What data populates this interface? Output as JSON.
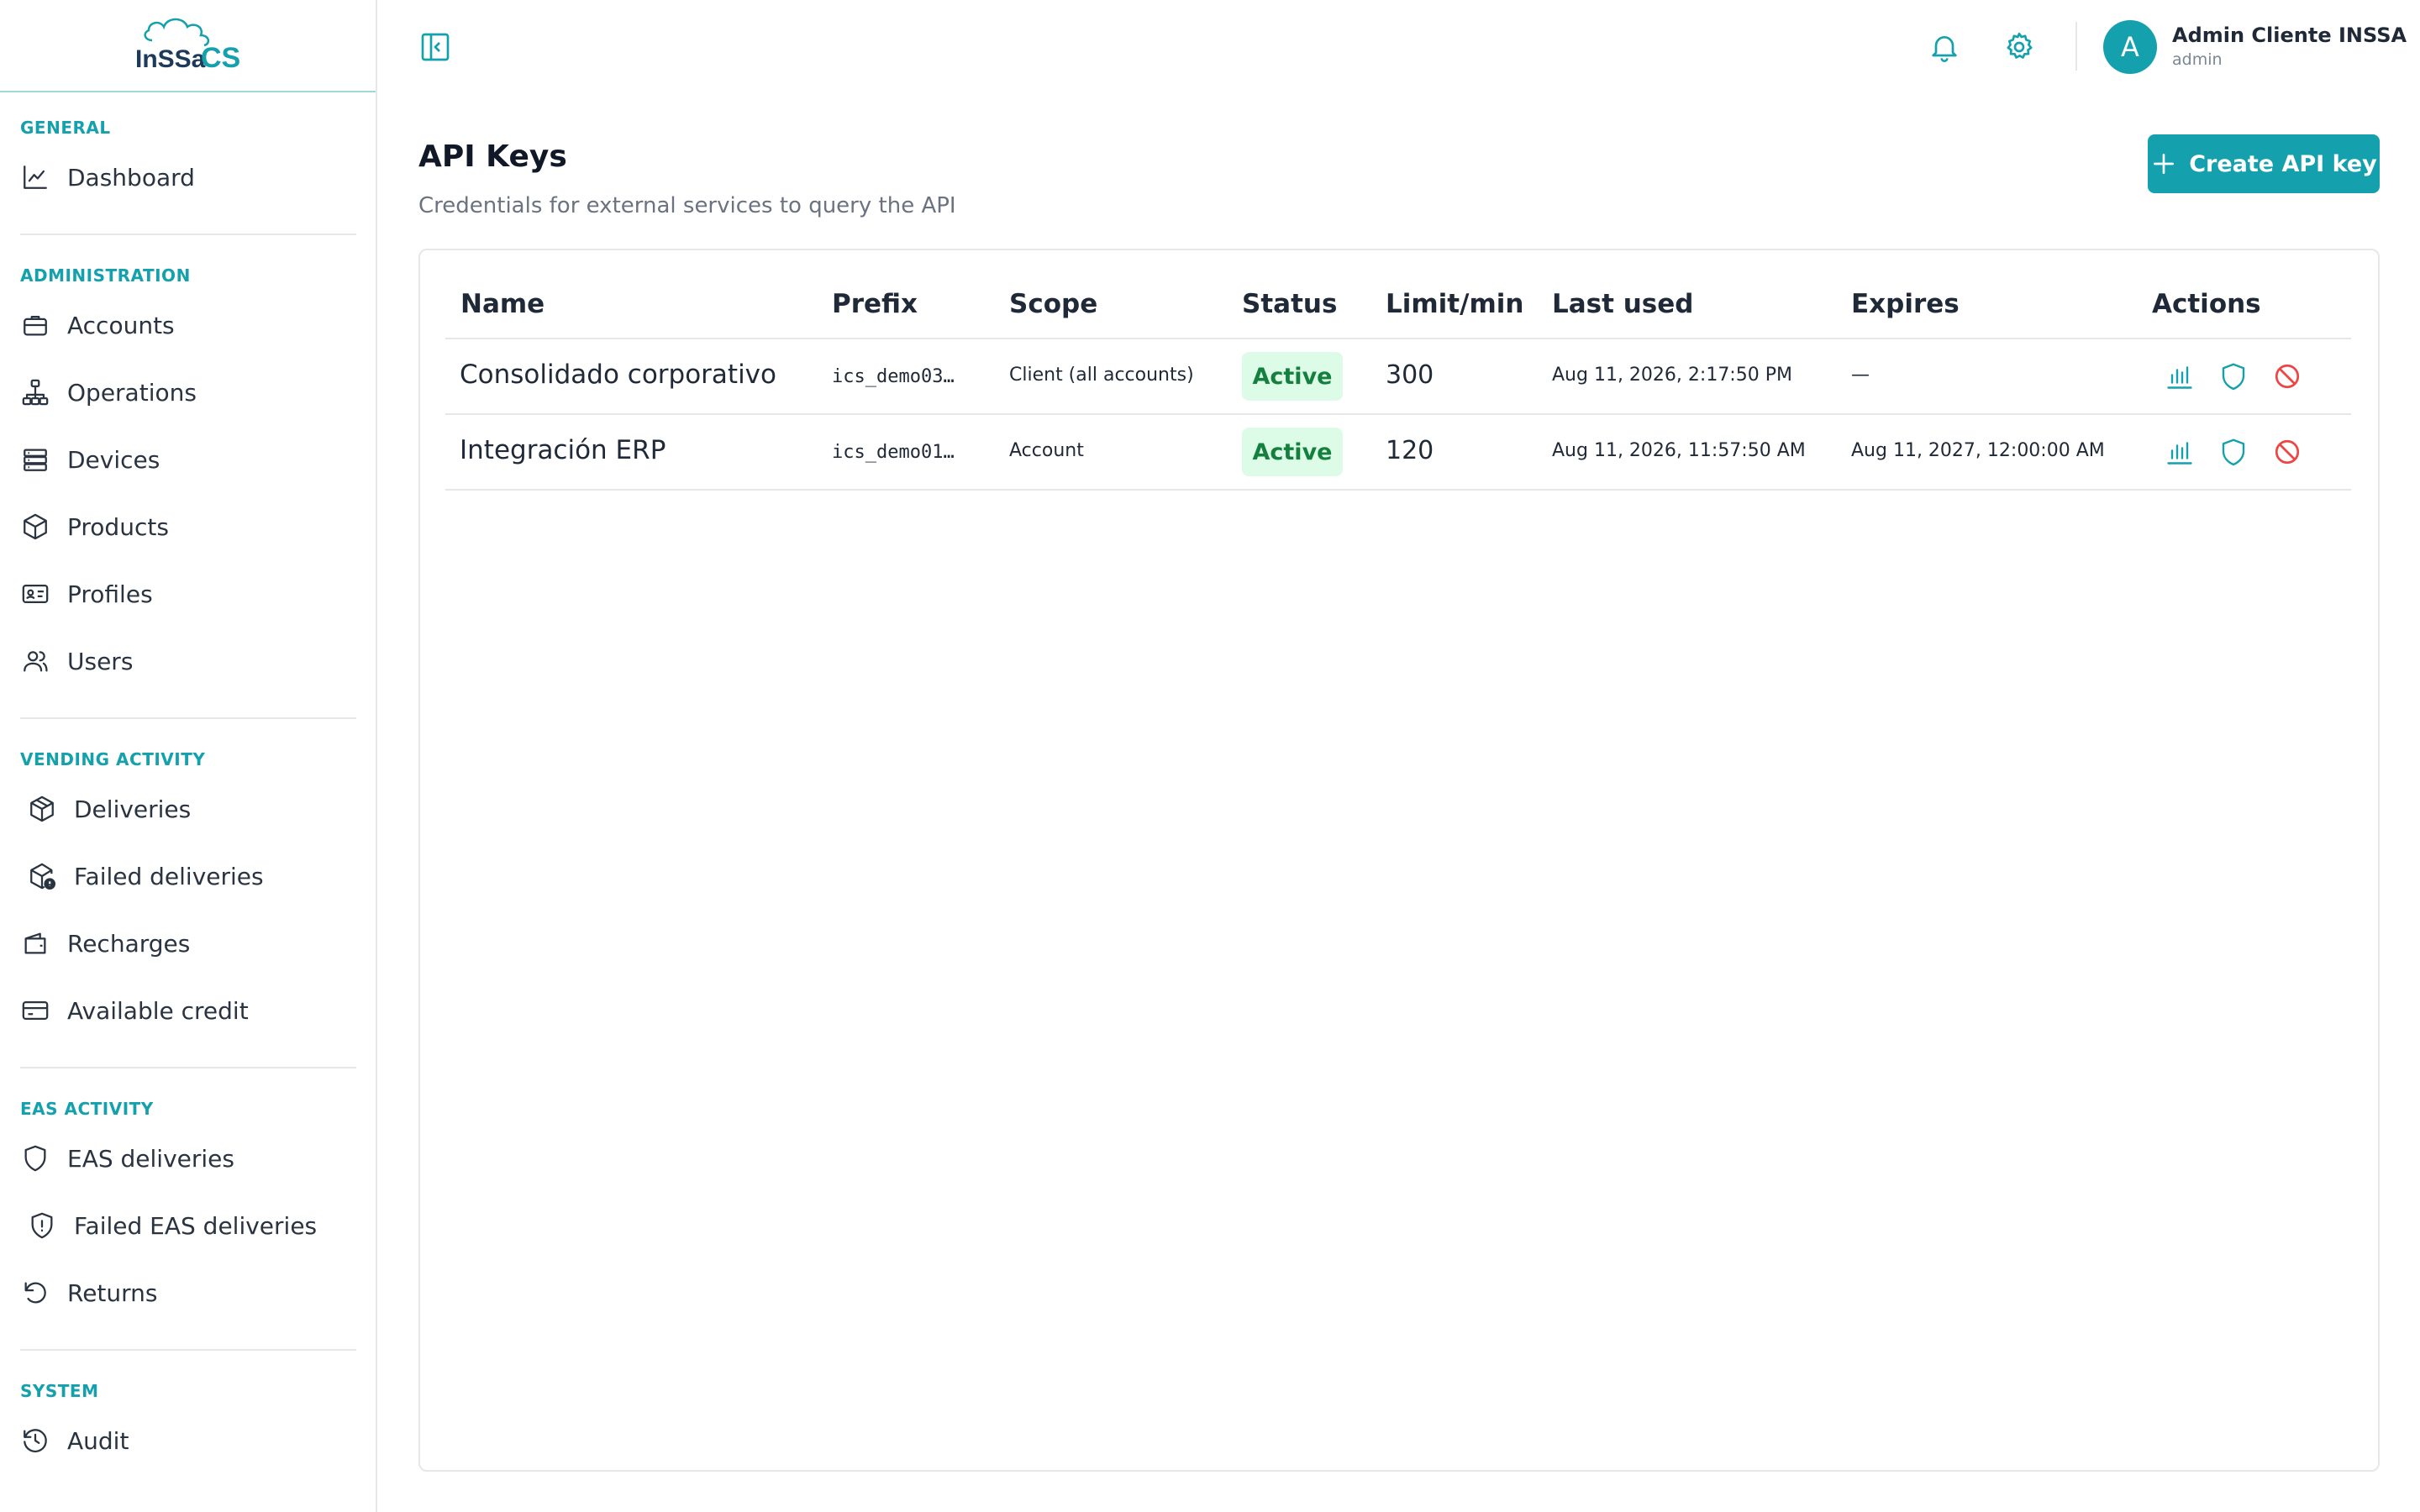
{
  "brand": {
    "logo_text": "INSSA CS",
    "primary_color": "#14a1ad"
  },
  "sidebar": {
    "sections": [
      {
        "label": "GENERAL",
        "items": [
          {
            "label": "Dashboard",
            "icon": "chart-line-icon"
          }
        ]
      },
      {
        "label": "ADMINISTRATION",
        "items": [
          {
            "label": "Accounts",
            "icon": "briefcase-icon"
          },
          {
            "label": "Operations",
            "icon": "network-icon"
          },
          {
            "label": "Devices",
            "icon": "server-icon"
          },
          {
            "label": "Products",
            "icon": "box-icon"
          },
          {
            "label": "Profiles",
            "icon": "id-card-icon"
          },
          {
            "label": "Users",
            "icon": "users-icon"
          }
        ]
      },
      {
        "label": "VENDING ACTIVITY",
        "items": [
          {
            "label": "Deliveries",
            "icon": "package-icon"
          },
          {
            "label": "Failed deliveries",
            "icon": "package-alert-icon"
          },
          {
            "label": "Recharges",
            "icon": "wallet-icon"
          },
          {
            "label": "Available credit",
            "icon": "credit-card-icon"
          }
        ]
      },
      {
        "label": "EAS ACTIVITY",
        "items": [
          {
            "label": "EAS deliveries",
            "icon": "shield-icon"
          },
          {
            "label": "Failed EAS deliveries",
            "icon": "shield-alert-icon"
          },
          {
            "label": "Returns",
            "icon": "undo-icon"
          }
        ]
      },
      {
        "label": "SYSTEM",
        "items": [
          {
            "label": "Audit",
            "icon": "history-icon"
          }
        ]
      }
    ]
  },
  "topbar": {
    "icons": [
      "sidebar-toggle-icon",
      "bell-icon",
      "gear-icon"
    ],
    "user": {
      "avatar_letter": "A",
      "name": "Admin Cliente INSSA",
      "role": "admin"
    }
  },
  "page": {
    "title": "API Keys",
    "subtitle": "Credentials for external services to query the API",
    "create_button": "Create API key"
  },
  "table": {
    "columns": [
      "Name",
      "Prefix",
      "Scope",
      "Status",
      "Limit/min",
      "Last used",
      "Expires",
      "Actions"
    ],
    "rows": [
      {
        "name": "Consolidado corporativo",
        "prefix": "ics_demo03…",
        "scope": "Client (all accounts)",
        "status": "Active",
        "limit": "300",
        "last_used": "Aug 11, 2026, 2:17:50 PM",
        "expires": "—"
      },
      {
        "name": "Integración ERP",
        "prefix": "ics_demo01…",
        "scope": "Account",
        "status": "Active",
        "limit": "120",
        "last_used": "Aug 11, 2026, 11:57:50 AM",
        "expires": "Aug 11, 2027, 12:00:00 AM"
      }
    ],
    "row_actions": [
      {
        "icon": "bar-chart-icon",
        "color": "#14a1ad"
      },
      {
        "icon": "shield-icon",
        "color": "#14a1ad"
      },
      {
        "icon": "ban-icon",
        "color": "#ef4444"
      }
    ],
    "status_colors": {
      "bg": "#dcfce7",
      "text": "#15803d"
    }
  }
}
